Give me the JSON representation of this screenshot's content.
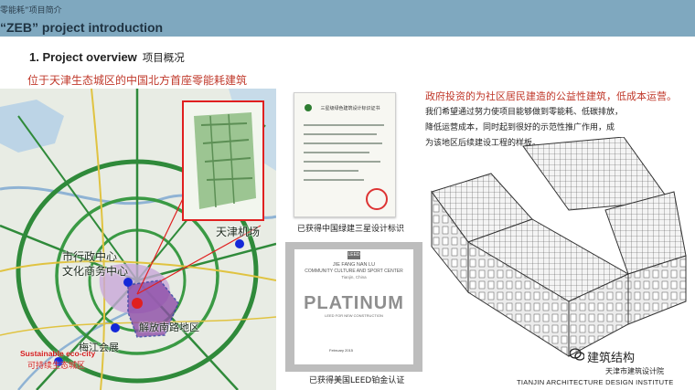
{
  "header": {
    "subtitle": "零能耗”项目简介",
    "title": "“ZEB” project introduction"
  },
  "section": {
    "title": "1.  Project overview",
    "title_cn": "项目概况",
    "subtitle": "位于天津生态城区的中国北方首座零能耗建筑"
  },
  "map": {
    "labels": {
      "airport": "天津机场",
      "city_center_1": "市行政中心",
      "city_center_2": "文化商务中心",
      "jiefang": "解放南路地区",
      "meijiang": "梅江会展",
      "eco_city_en": "Sustainable eco-city",
      "eco_city_cn": "可持续生态城区"
    }
  },
  "certificate": {
    "heading": "三星级绿色建筑设计标识证书",
    "caption": "已获得中国绿建三星设计标识"
  },
  "leed": {
    "logo": "LEED",
    "name": "JIE FANG NAN LU",
    "center": "COMMUNITY CULTURE AND SPORT CENTER",
    "location": "Tianjin, China",
    "level": "PLATINUM",
    "rating": "LEED FOR NEW CONSTRUCTION",
    "date": "February 2015",
    "caption": "已获得美国LEED铂金认证"
  },
  "description": {
    "heading": "政府投资的为社区居民建造的公益性建筑，低成本运营。",
    "lines": [
      "我们希望通过努力使项目能够做到零能耗、低碳排放，",
      "降低运营成本，同时起到很好的示范性推广作用，成",
      "为该地区后续建设工程的样板。"
    ]
  },
  "watermark": {
    "brand": "建筑结构",
    "institute_cn": "天津市建筑设计院",
    "institute_en": "TIANJIN ARCHITECTURE DESIGN INSTITUTE"
  },
  "colors": {
    "topbar": "#7fa8bf",
    "accent_red": "#c0392b",
    "road_green": "#2f8a3a",
    "marker_blue": "#1428d8",
    "zone_purple": "#b07bd3"
  }
}
